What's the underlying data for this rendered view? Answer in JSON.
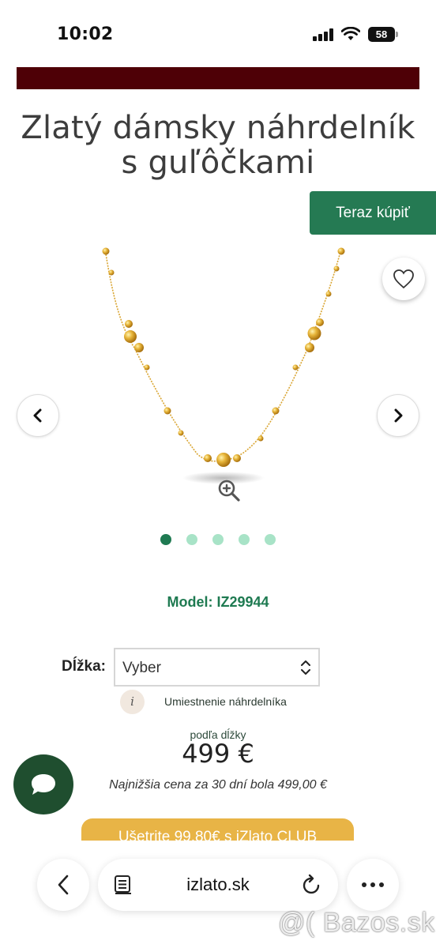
{
  "status_bar": {
    "time": "10:02",
    "battery": "58"
  },
  "product": {
    "title_line1": "Zlatý dámsky náhrdelník",
    "title_line2": "s guľôčkami",
    "buy_button": "Teraz kúpiť",
    "model": "Model: IZ29944",
    "length_label": "Dĺžka:",
    "length_value": "Vyber",
    "info_icon_letter": "i",
    "info_link": "Umiestnenie náhrdelníka",
    "price_note": "podľa dĺžky",
    "price": "499 €",
    "lowest_price": "Najnižšia cena za 30 dní bola 499,00 €",
    "club_button": "Ušetrite 99,80€ s iZlato CLUB"
  },
  "gallery": {
    "total_images": 5,
    "active_index": 0
  },
  "browser": {
    "domain": "izlato.sk"
  },
  "watermark": "@( Bazos.sk",
  "colors": {
    "accent_green": "#257a53",
    "brand_maroon": "#4e0006",
    "dot_active": "#1f7a52",
    "dot_inactive": "#a8e3c7",
    "club_yellow": "#e8b446",
    "chat_green": "#1f4e2f"
  },
  "icons": [
    "signal-icon",
    "wifi-icon",
    "battery-icon",
    "heart-icon",
    "chevron-left-icon",
    "chevron-right-icon",
    "zoom-in-icon",
    "select-chevron-icon",
    "info-icon",
    "chat-bubble-icon",
    "back-icon",
    "reader-icon",
    "reload-icon",
    "more-icon"
  ]
}
